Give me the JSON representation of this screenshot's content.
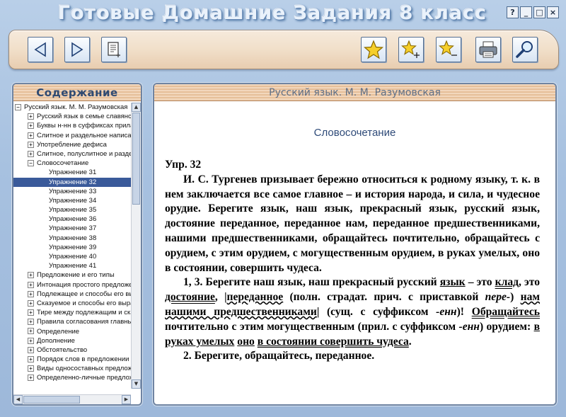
{
  "window": {
    "title": "Готовые Домашние Задания 8 класс",
    "controls": [
      "?",
      "_",
      "□",
      "×"
    ]
  },
  "toolbar": {
    "buttons": [
      "back",
      "forward",
      "notes",
      "bookmark",
      "bookmark-add",
      "bookmark-remove",
      "print",
      "search"
    ]
  },
  "sidebar": {
    "header": "Содержание",
    "tree": [
      {
        "label": "Русский язык. М. М. Разумовская",
        "level": 0,
        "toggle": "−"
      },
      {
        "label": "Русский язык в семье славянских языков",
        "level": 1,
        "toggle": "+"
      },
      {
        "label": "Буквы н-нн в суффиксах прилагательных",
        "level": 1,
        "toggle": "+"
      },
      {
        "label": "Слитное и раздельное написание",
        "level": 1,
        "toggle": "+"
      },
      {
        "label": "Употребление дефиса",
        "level": 1,
        "toggle": "+"
      },
      {
        "label": "Слитное, полуслитное и раздельное",
        "level": 1,
        "toggle": "+"
      },
      {
        "label": "Словосочетание",
        "level": 1,
        "toggle": "−"
      },
      {
        "label": "Упражнение 31",
        "level": 2
      },
      {
        "label": "Упражнение 32",
        "level": 2,
        "selected": true
      },
      {
        "label": "Упражнение 33",
        "level": 2
      },
      {
        "label": "Упражнение 34",
        "level": 2
      },
      {
        "label": "Упражнение 35",
        "level": 2
      },
      {
        "label": "Упражнение 36",
        "level": 2
      },
      {
        "label": "Упражнение 37",
        "level": 2
      },
      {
        "label": "Упражнение 38",
        "level": 2
      },
      {
        "label": "Упражнение 39",
        "level": 2
      },
      {
        "label": "Упражнение 40",
        "level": 2
      },
      {
        "label": "Упражнение 41",
        "level": 2
      },
      {
        "label": "Предложение и его типы",
        "level": 1,
        "toggle": "+"
      },
      {
        "label": "Интонация простого предложения",
        "level": 1,
        "toggle": "+"
      },
      {
        "label": "Подлежащее и способы его выражения",
        "level": 1,
        "toggle": "+"
      },
      {
        "label": "Сказуемое и способы его выражения",
        "level": 1,
        "toggle": "+"
      },
      {
        "label": "Тире между подлежащим и сказуемым",
        "level": 1,
        "toggle": "+"
      },
      {
        "label": "Правила согласования главных членов",
        "level": 1,
        "toggle": "+"
      },
      {
        "label": "Определение",
        "level": 1,
        "toggle": "+"
      },
      {
        "label": "Дополнение",
        "level": 1,
        "toggle": "+"
      },
      {
        "label": "Обстоятельство",
        "level": 1,
        "toggle": "+"
      },
      {
        "label": "Порядок слов в предложении",
        "level": 1,
        "toggle": "+"
      },
      {
        "label": "Виды односоставных предложений",
        "level": 1,
        "toggle": "+"
      },
      {
        "label": "Определенно-личные предложения",
        "level": 1,
        "toggle": "+"
      }
    ]
  },
  "content": {
    "header": "Русский язык. М. М. Разумовская",
    "title": "Словосочетание",
    "exercise": "Упр. 32",
    "paragraph1": "И. С. Тургенев призывает бережно относиться к родному языку, т. к. в нем заключается все самое главное – и история народа, и сила, и чудесное орудие. Берегите язык, наш язык, прекрасный язык, русский язык, достояние переданное, переданное нам, переданное предшественниками, нашими предшественниками, обращайтесь почтительно, обращайтесь с орудием, с этим орудием, с могущественным орудием, в руках умелых, оно в состоянии, совершить чудеса.",
    "p2": {
      "a": "1, 3. Берегите наш язык, наш прекрасный русский ",
      "b": "язык",
      "c": " – это ",
      "d": "клад",
      "e": ", это ",
      "f": "достояние",
      "g": ", |",
      "h": "переданное",
      "i": " (полн. страдат. прич. с приставкой ",
      "j": "пере-",
      "k": ") ",
      "l": "нам нашими предшественниками",
      "m": "| (сущ. с суффиксом ",
      "n": "-енн",
      "o": ")! ",
      "p": "Обращайтесь",
      "q": " почтительно с этим могущественным (прил. с суффиксом ",
      "r": "-енн",
      "s": ") орудием: ",
      "t": "в руках умелых",
      "u": " ",
      "v": "оно",
      "w": " ",
      "x": "в состоянии совершить чудеса",
      "y": "."
    },
    "p3": "2. Берегите, обращайтесь, переданное."
  },
  "colors": {
    "background": "#a7c1e0",
    "toolbar": "#f1dfc9",
    "selected": "#3a5a9a",
    "title_text": "#2e4a78"
  }
}
